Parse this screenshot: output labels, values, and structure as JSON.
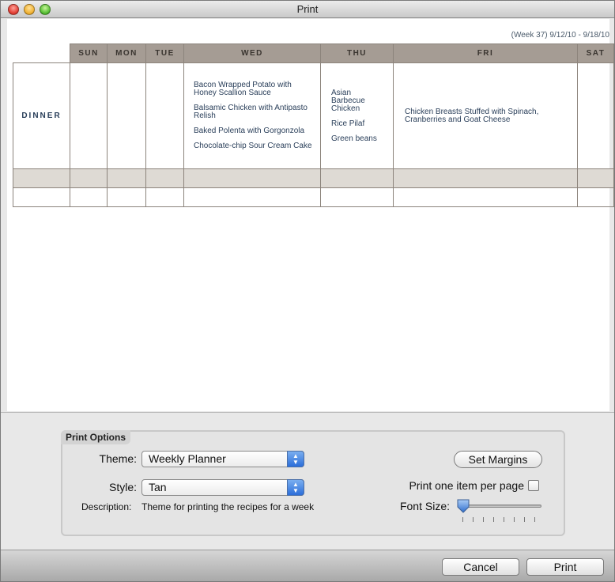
{
  "window": {
    "title": "Print"
  },
  "preview": {
    "week_range": "(Week 37) 9/12/10 - 9/18/10",
    "days": [
      "SUN",
      "MON",
      "TUE",
      "WED",
      "THU",
      "FRI",
      "SAT"
    ],
    "row_label": "DINNER",
    "meals": {
      "wed": [
        "Bacon Wrapped Potato with Honey Scallion Sauce",
        "Balsamic Chicken with Antipasto Relish",
        "Baked Polenta with Gorgonzola",
        "Chocolate-chip Sour Cream Cake"
      ],
      "thu": [
        "Asian Barbecue Chicken",
        "Rice Pilaf",
        "Green beans"
      ],
      "fri": [
        "Chicken Breasts Stuffed with Spinach, Cranberries and Goat Cheese"
      ]
    }
  },
  "options": {
    "group_title": "Print Options",
    "theme_label": "Theme:",
    "theme_value": "Weekly Planner",
    "style_label": "Style:",
    "style_value": "Tan",
    "description_label": "Description:",
    "description_value": "Theme for printing the recipes for a week",
    "set_margins_label": "Set Margins",
    "one_item_label": "Print one item per page",
    "one_item_checked": false,
    "font_size_label": "Font Size:",
    "font_size_level": 0
  },
  "footer": {
    "cancel_label": "Cancel",
    "print_label": "Print"
  },
  "colors": {
    "header": "#a59c94",
    "tan_row": "#dedad4",
    "text": "#2a3f5a",
    "accent": "#2c6ed9"
  }
}
